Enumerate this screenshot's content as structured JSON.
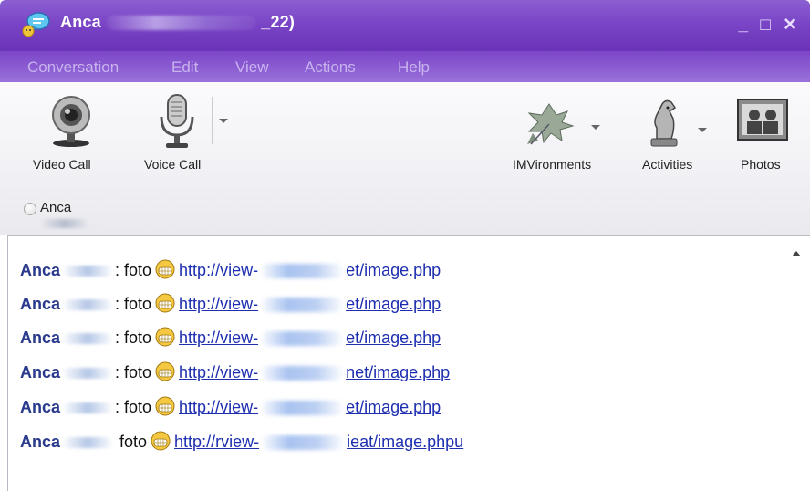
{
  "window": {
    "title_name": "Anca",
    "title_suffix": "_22)",
    "controls": "_ □ ✕"
  },
  "menu": [
    {
      "label": "Conversation"
    },
    {
      "label": "Edit"
    },
    {
      "label": "View"
    },
    {
      "label": "Actions"
    },
    {
      "label": "Help"
    }
  ],
  "toolbar": {
    "video_call": "Video Call",
    "voice_call": "Voice Call",
    "imvironments": "IMVironments",
    "activities": "Activities",
    "photos": "Photos"
  },
  "contact": {
    "name": "Anca"
  },
  "messages": [
    {
      "sender": "Anca",
      "text": ": foto",
      "link_start": "http://view-",
      "link_end": "et/image.php"
    },
    {
      "sender": "Anca",
      "text": ": foto",
      "link_start": "http://view-",
      "link_end": "et/image.php"
    },
    {
      "sender": "Anca",
      "text": ": foto",
      "link_start": "http://view-",
      "link_end": "et/image.php"
    },
    {
      "sender": "Anca",
      "text": ": foto",
      "link_start": "http://view-",
      "link_end": "net/image.php"
    },
    {
      "sender": "Anca",
      "text": ": foto",
      "link_start": "http://view-",
      "link_end": "et/image.php"
    },
    {
      "sender": "Anca",
      "text": " foto",
      "link_start": "http://rview-",
      "link_end": "ieat/image.phpu"
    }
  ],
  "colors": {
    "title_bar": "#7a45c6",
    "sender": "#2a3a8c",
    "link": "#1d2fb0"
  }
}
